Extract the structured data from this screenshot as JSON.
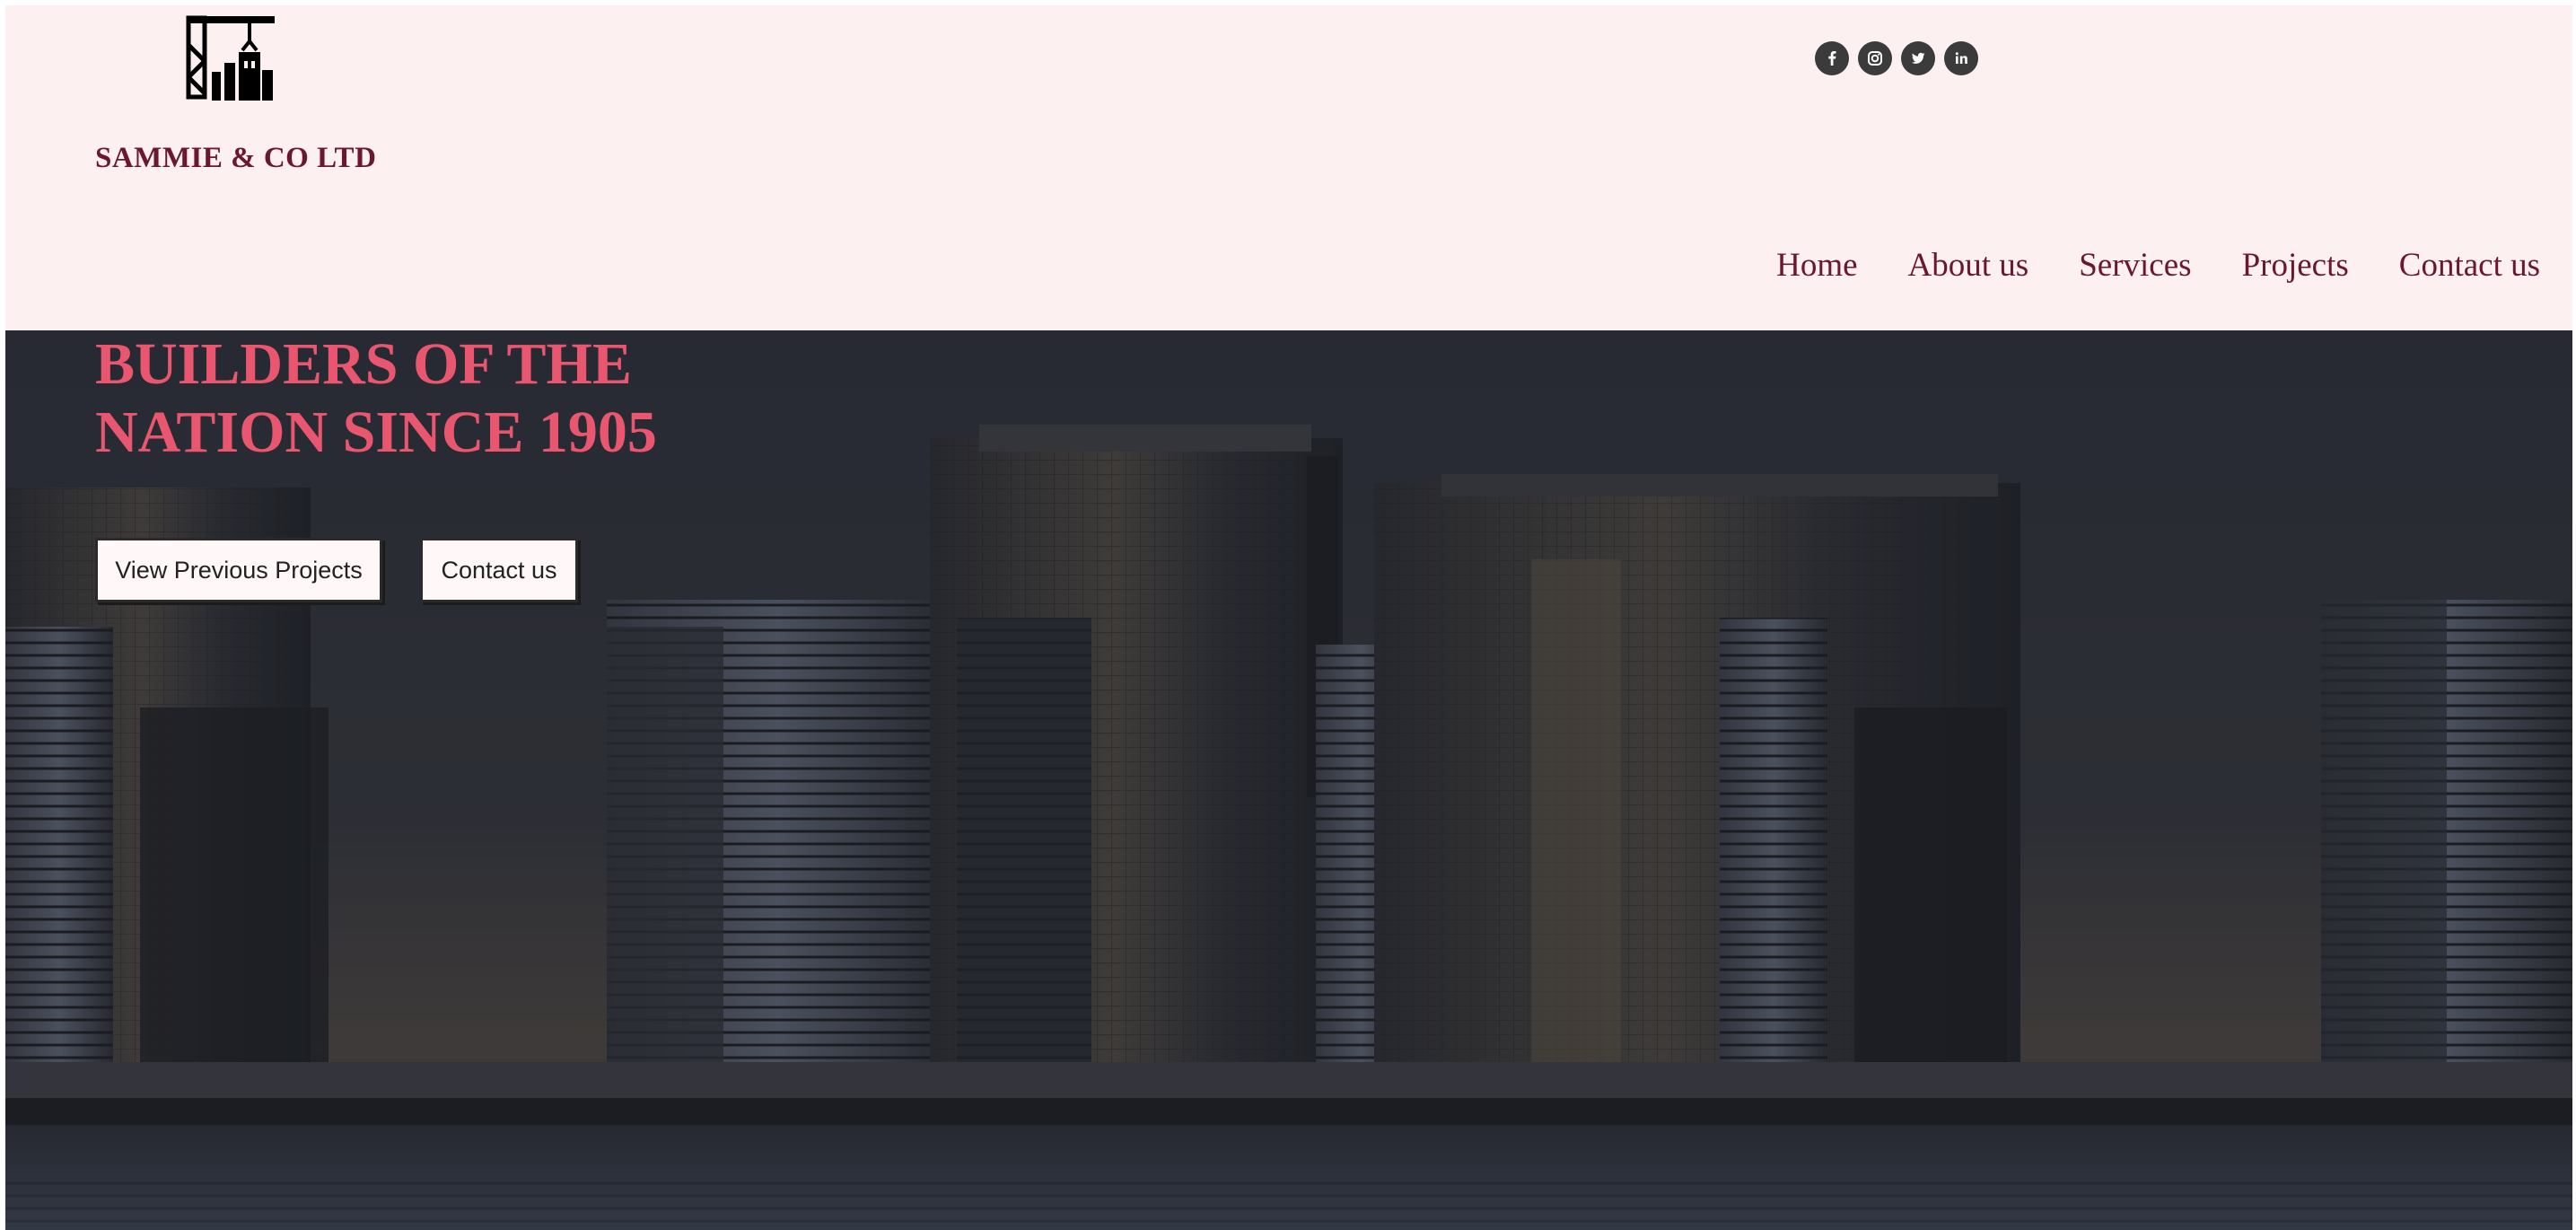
{
  "brand": {
    "name": "SAMMIE & CO LTD",
    "logo_icon": "crane-building-logo-icon"
  },
  "social": [
    {
      "name": "facebook-icon",
      "glyph": "f"
    },
    {
      "name": "instagram-icon",
      "glyph": ""
    },
    {
      "name": "twitter-icon",
      "glyph": ""
    },
    {
      "name": "linkedin-icon",
      "glyph": "in"
    }
  ],
  "nav": {
    "items": [
      {
        "label": "Home"
      },
      {
        "label": "About us"
      },
      {
        "label": "Services"
      },
      {
        "label": "Projects"
      },
      {
        "label": "Contact us"
      }
    ]
  },
  "hero": {
    "title_line1": "BUILDERS OF THE",
    "title_line2": "NATION SINCE 1905",
    "buttons": {
      "projects": "View Previous Projects",
      "contact": "Contact us"
    }
  },
  "colors": {
    "header_bg": "#fcf0f1",
    "brand": "#6b1730",
    "hero_title": "#e8566f",
    "button_bg": "#fff7f8",
    "hero_overlay": "#2c3039"
  }
}
